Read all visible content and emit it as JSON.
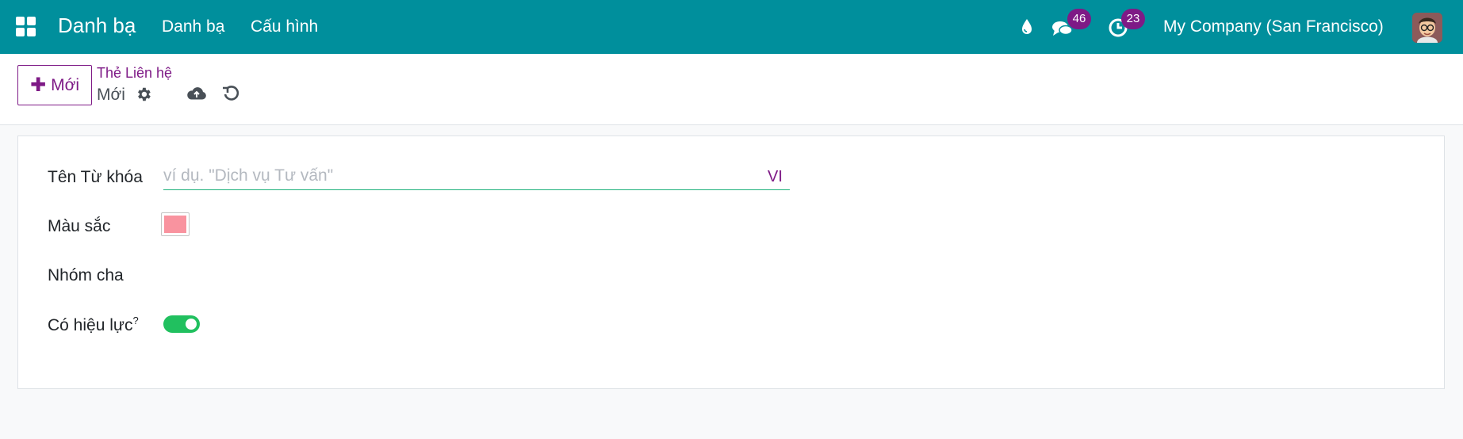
{
  "navbar": {
    "app_title": "Danh bạ",
    "menu": [
      "Danh bạ",
      "Cấu hình"
    ],
    "messages_badge": "46",
    "activities_badge": "23",
    "company": "My Company (San Francisco)",
    "icons": [
      "apps-grid-icon",
      "droplet-icon",
      "chat-icon",
      "clock-icon"
    ]
  },
  "control_panel": {
    "new_button": "Mới",
    "breadcrumb_parent": "Thẻ Liên hệ",
    "record_name": "Mới",
    "icons": [
      "gear-icon",
      "cloud-upload-icon",
      "undo-icon"
    ]
  },
  "form": {
    "name_label": "Tên Từ khóa",
    "name_placeholder": "ví dụ. \"Dịch vụ Tư vấn\"",
    "name_value": "",
    "lang_tag": "VI",
    "color_label": "Màu sắc",
    "color_value": "#f9939f",
    "parent_label": "Nhóm cha",
    "active_label": "Có hiệu lực",
    "active_help": "?",
    "active_on": true
  },
  "colors": {
    "navbar": "#008f9c",
    "primary": "#7e1a86",
    "toggle_on": "#21c05f",
    "input_underline": "#20b27c"
  }
}
